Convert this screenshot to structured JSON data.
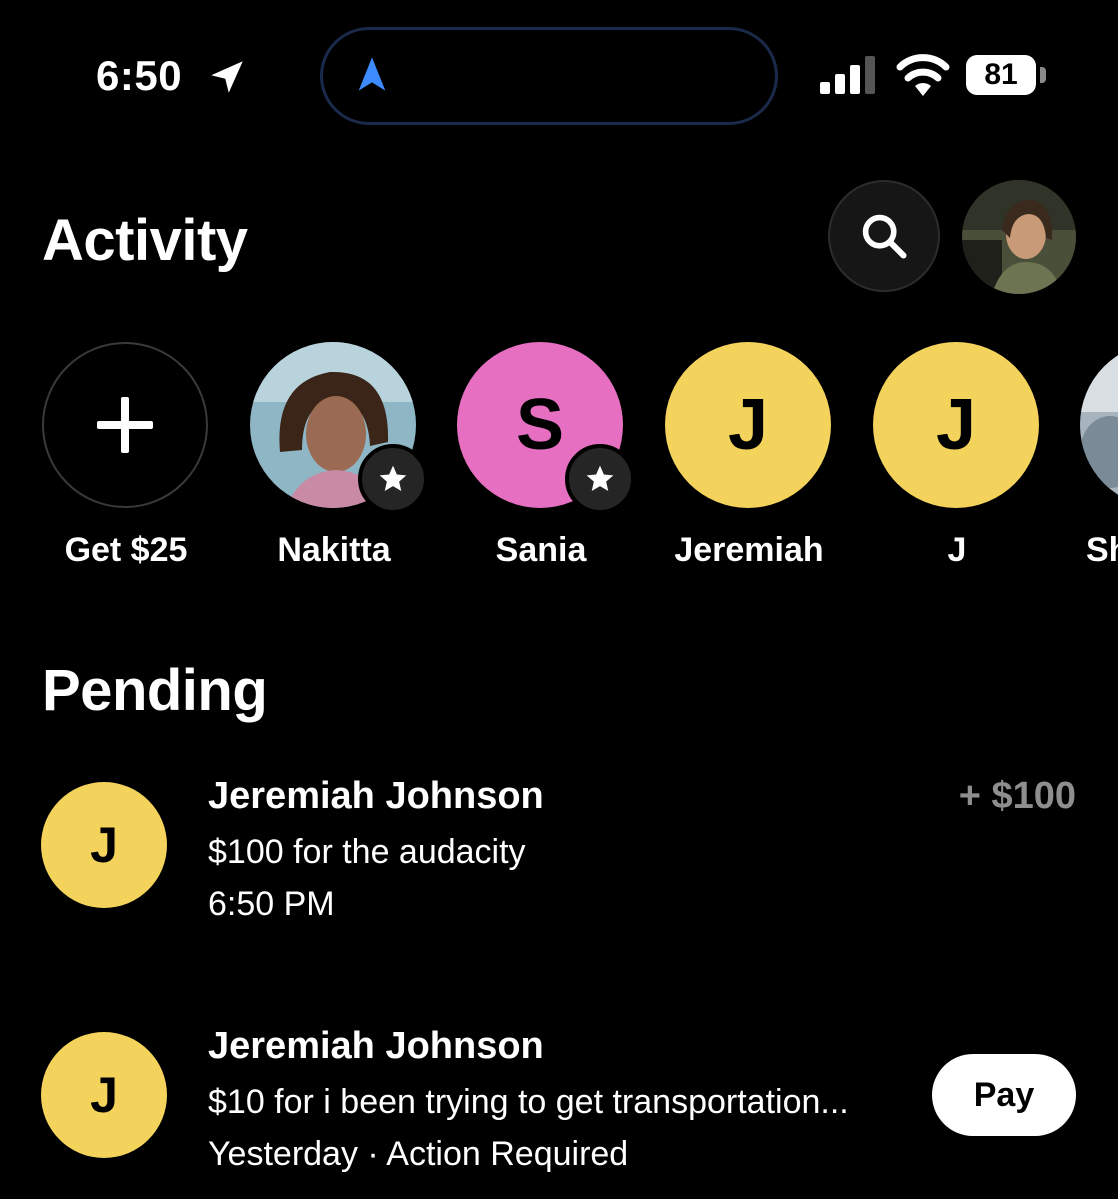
{
  "status_bar": {
    "time": "6:50",
    "battery": "81",
    "icons": [
      "location-arrow-icon",
      "navigation-icon",
      "signal-icon",
      "wifi-icon",
      "battery-icon"
    ]
  },
  "header": {
    "title": "Activity",
    "icons": [
      "search-icon",
      "profile-avatar"
    ]
  },
  "contacts": [
    {
      "label": "Get $25",
      "type": "add",
      "icon": "plus-icon"
    },
    {
      "label": "Nakitta",
      "type": "photo",
      "starred": true
    },
    {
      "label": "Sania",
      "type": "initial",
      "initial": "S",
      "color": "#e76fc2",
      "starred": true
    },
    {
      "label": "Jeremiah",
      "type": "initial",
      "initial": "J",
      "color": "#f3d35b"
    },
    {
      "label": "J",
      "type": "initial",
      "initial": "J",
      "color": "#f3d35b"
    },
    {
      "label": "Sh",
      "type": "photo"
    }
  ],
  "pending": {
    "title": "Pending",
    "items": [
      {
        "initial": "J",
        "name": "Jeremiah Johnson",
        "note": "$100 for the audacity",
        "meta": "6:50 PM",
        "amount": "+ $100"
      },
      {
        "initial": "J",
        "name": "Jeremiah Johnson",
        "note": "$10 for i been trying to get transportation...",
        "meta": "Yesterday · Action Required",
        "action": "Pay"
      }
    ]
  },
  "colors": {
    "background": "#000000",
    "yellow_avatar": "#f3d35b",
    "pink_avatar": "#e76fc2",
    "muted_amount": "#8e8e8e",
    "nav_blue": "#3d8bff"
  }
}
